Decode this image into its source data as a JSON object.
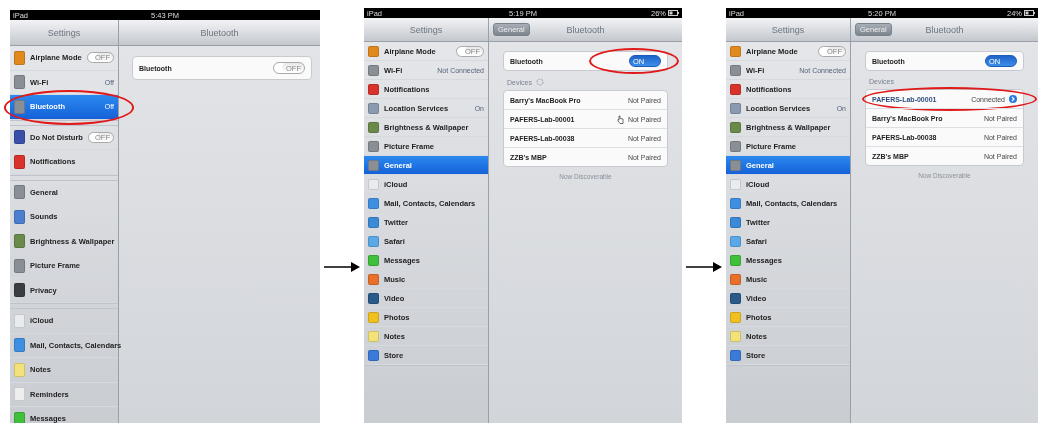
{
  "panels": [
    {
      "status_bar": {
        "carrier": "iPad",
        "time": "5:43 PM"
      },
      "sidebar": {
        "title": "Settings",
        "groups": [
          {
            "items": [
              {
                "label": "Airplane Mode",
                "kind": "toggle",
                "on": false,
                "toggle_label": "OFF",
                "color": "#e08a1e",
                "selected": false,
                "circled": false
              },
              {
                "label": "Wi-Fi",
                "kind": "value",
                "value": "Off",
                "color": "#8a8f96",
                "selected": false,
                "circled": false
              },
              {
                "label": "Bluetooth",
                "kind": "value",
                "value": "Off",
                "color": "#8a8f96",
                "selected": true,
                "circled": true
              }
            ]
          },
          {
            "items": [
              {
                "label": "Do Not Disturb",
                "kind": "toggle",
                "on": false,
                "toggle_label": "OFF",
                "color": "#3b4fa8",
                "selected": false,
                "circled": false
              },
              {
                "label": "Notifications",
                "kind": "plain",
                "color": "#d8322a",
                "selected": false,
                "circled": false
              }
            ]
          },
          {
            "items": [
              {
                "label": "General",
                "kind": "plain",
                "color": "#8a8f96",
                "selected": false,
                "circled": false
              },
              {
                "label": "Sounds",
                "kind": "plain",
                "color": "#4a7fd0",
                "selected": false,
                "circled": false
              },
              {
                "label": "Brightness & Wallpaper",
                "kind": "plain",
                "color": "#6a8a4a",
                "selected": false,
                "circled": false
              },
              {
                "label": "Picture Frame",
                "kind": "plain",
                "color": "#8a8f96",
                "selected": false,
                "circled": false
              },
              {
                "label": "Privacy",
                "kind": "plain",
                "color": "#3a3d42",
                "selected": false,
                "circled": false
              }
            ]
          },
          {
            "items": [
              {
                "label": "iCloud",
                "kind": "plain",
                "color": "#e9ecef",
                "selected": false,
                "circled": false
              },
              {
                "label": "Mail, Contacts, Calendars",
                "kind": "plain",
                "color": "#3f8fe0",
                "selected": false,
                "circled": false
              },
              {
                "label": "Notes",
                "kind": "plain",
                "color": "#f3e27a",
                "selected": false,
                "circled": false
              },
              {
                "label": "Reminders",
                "kind": "plain",
                "color": "#eeeeee",
                "selected": false,
                "circled": false
              },
              {
                "label": "Messages",
                "kind": "plain",
                "color": "#3fbf3a",
                "selected": false,
                "circled": false
              }
            ]
          }
        ]
      },
      "detail": {
        "title": "Bluetooth",
        "bluetooth_row": {
          "label": "Bluetooth",
          "on": false,
          "toggle_label": "OFF",
          "circled": false
        }
      }
    },
    {
      "status_bar": {
        "carrier": "iPad",
        "time": "5:19 PM",
        "battery": "26%"
      },
      "sidebar": {
        "title": "Settings",
        "groups": [
          {
            "items": [
              {
                "label": "Airplane Mode",
                "kind": "toggle",
                "on": false,
                "toggle_label": "OFF",
                "color": "#e08a1e",
                "selected": false,
                "circled": false
              },
              {
                "label": "Wi-Fi",
                "kind": "value",
                "value": "Not Connected",
                "color": "#8a8f96",
                "selected": false,
                "circled": false
              },
              {
                "label": "Notifications",
                "kind": "plain",
                "color": "#d8322a",
                "selected": false,
                "circled": false
              },
              {
                "label": "Location Services",
                "kind": "value",
                "value": "On",
                "color": "#8a9bb0",
                "selected": false,
                "circled": false
              },
              {
                "label": "Brightness & Wallpaper",
                "kind": "plain",
                "color": "#6a8a4a",
                "selected": false,
                "circled": false
              },
              {
                "label": "Picture Frame",
                "kind": "plain",
                "color": "#8a8f96",
                "selected": false,
                "circled": false
              },
              {
                "label": "General",
                "kind": "plain",
                "color": "#8a8f96",
                "selected": true,
                "circled": false
              },
              {
                "label": "iCloud",
                "kind": "plain",
                "color": "#e9ecef",
                "selected": false,
                "circled": false
              },
              {
                "label": "Mail, Contacts, Calendars",
                "kind": "plain",
                "color": "#3f8fe0",
                "selected": false,
                "circled": false
              },
              {
                "label": "Twitter",
                "kind": "plain",
                "color": "#3a8ad8",
                "selected": false,
                "circled": false
              },
              {
                "label": "Safari",
                "kind": "plain",
                "color": "#5aa8e8",
                "selected": false,
                "circled": false
              },
              {
                "label": "Messages",
                "kind": "plain",
                "color": "#3fbf3a",
                "selected": false,
                "circled": false
              },
              {
                "label": "Music",
                "kind": "plain",
                "color": "#e8702a",
                "selected": false,
                "circled": false
              },
              {
                "label": "Video",
                "kind": "plain",
                "color": "#2a5a8a",
                "selected": false,
                "circled": false
              },
              {
                "label": "Photos",
                "kind": "plain",
                "color": "#f0c020",
                "selected": false,
                "circled": false
              },
              {
                "label": "Notes",
                "kind": "plain",
                "color": "#f3e27a",
                "selected": false,
                "circled": false
              },
              {
                "label": "Store",
                "kind": "plain",
                "color": "#3a7ad8",
                "selected": false,
                "circled": false
              }
            ]
          }
        ]
      },
      "detail": {
        "title": "Bluetooth",
        "back_button": "General",
        "bluetooth_row": {
          "label": "Bluetooth",
          "on": true,
          "toggle_label": "ON",
          "circled": true
        },
        "devices_heading": "Devices",
        "searching": true,
        "devices": [
          {
            "name": "Barry's MacBook Pro",
            "status": "Not Paired",
            "connected": false,
            "circled": false,
            "cursor": false
          },
          {
            "name": "PAFERS-Lab-00001",
            "status": "Not Paired",
            "connected": false,
            "circled": false,
            "cursor": true
          },
          {
            "name": "PAFERS-Lab-00038",
            "status": "Not Paired",
            "connected": false,
            "circled": false,
            "cursor": false
          },
          {
            "name": "ZZB's MBP",
            "status": "Not Paired",
            "connected": false,
            "circled": false,
            "cursor": false
          }
        ],
        "footer": "Now Discoverable"
      }
    },
    {
      "status_bar": {
        "carrier": "iPad",
        "time": "5:20 PM",
        "battery": "24%"
      },
      "sidebar": {
        "title": "Settings",
        "groups": [
          {
            "items": [
              {
                "label": "Airplane Mode",
                "kind": "toggle",
                "on": false,
                "toggle_label": "OFF",
                "color": "#e08a1e",
                "selected": false,
                "circled": false
              },
              {
                "label": "Wi-Fi",
                "kind": "value",
                "value": "Not Connected",
                "color": "#8a8f96",
                "selected": false,
                "circled": false
              },
              {
                "label": "Notifications",
                "kind": "plain",
                "color": "#d8322a",
                "selected": false,
                "circled": false
              },
              {
                "label": "Location Services",
                "kind": "value",
                "value": "On",
                "color": "#8a9bb0",
                "selected": false,
                "circled": false
              },
              {
                "label": "Brightness & Wallpaper",
                "kind": "plain",
                "color": "#6a8a4a",
                "selected": false,
                "circled": false
              },
              {
                "label": "Picture Frame",
                "kind": "plain",
                "color": "#8a8f96",
                "selected": false,
                "circled": false
              },
              {
                "label": "General",
                "kind": "plain",
                "color": "#8a8f96",
                "selected": true,
                "circled": false
              },
              {
                "label": "iCloud",
                "kind": "plain",
                "color": "#e9ecef",
                "selected": false,
                "circled": false
              },
              {
                "label": "Mail, Contacts, Calendars",
                "kind": "plain",
                "color": "#3f8fe0",
                "selected": false,
                "circled": false
              },
              {
                "label": "Twitter",
                "kind": "plain",
                "color": "#3a8ad8",
                "selected": false,
                "circled": false
              },
              {
                "label": "Safari",
                "kind": "plain",
                "color": "#5aa8e8",
                "selected": false,
                "circled": false
              },
              {
                "label": "Messages",
                "kind": "plain",
                "color": "#3fbf3a",
                "selected": false,
                "circled": false
              },
              {
                "label": "Music",
                "kind": "plain",
                "color": "#e8702a",
                "selected": false,
                "circled": false
              },
              {
                "label": "Video",
                "kind": "plain",
                "color": "#2a5a8a",
                "selected": false,
                "circled": false
              },
              {
                "label": "Photos",
                "kind": "plain",
                "color": "#f0c020",
                "selected": false,
                "circled": false
              },
              {
                "label": "Notes",
                "kind": "plain",
                "color": "#f3e27a",
                "selected": false,
                "circled": false
              },
              {
                "label": "Store",
                "kind": "plain",
                "color": "#3a7ad8",
                "selected": false,
                "circled": false
              }
            ]
          }
        ]
      },
      "detail": {
        "title": "Bluetooth",
        "back_button": "General",
        "bluetooth_row": {
          "label": "Bluetooth",
          "on": true,
          "toggle_label": "ON",
          "circled": false
        },
        "devices_heading": "Devices",
        "searching": false,
        "devices": [
          {
            "name": "PAFERS-Lab-00001",
            "status": "Connected",
            "connected": true,
            "circled": true,
            "cursor": false
          },
          {
            "name": "Barry's MacBook Pro",
            "status": "Not Paired",
            "connected": false,
            "circled": false,
            "cursor": false
          },
          {
            "name": "PAFERS-Lab-00038",
            "status": "Not Paired",
            "connected": false,
            "circled": false,
            "cursor": false
          },
          {
            "name": "ZZB's MBP",
            "status": "Not Paired",
            "connected": false,
            "circled": false,
            "cursor": false
          }
        ],
        "footer": "Now Discoverable"
      }
    }
  ]
}
